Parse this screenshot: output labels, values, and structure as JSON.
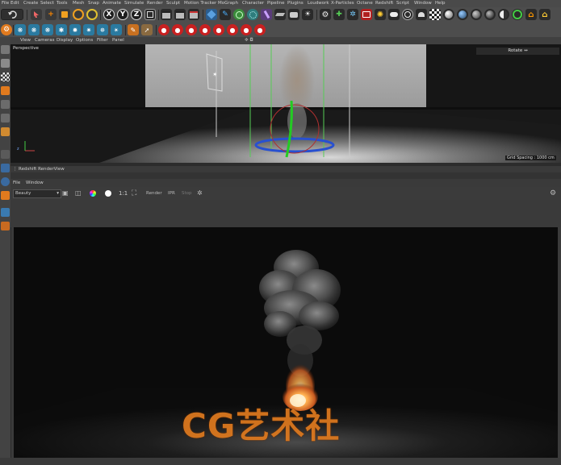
{
  "menu": [
    "File",
    "Edit",
    "Create",
    "Select",
    "Tools",
    "Mesh",
    "Snap",
    "Animate",
    "Simulate",
    "Render",
    "Sculpt",
    "Motion Tracker",
    "MoGraph",
    "Character",
    "Pipeline",
    "Plugins",
    "Loudwork",
    "X-Particles",
    "Octane",
    "Redshift",
    "Script",
    "Window",
    "Help"
  ],
  "toolbar1": {
    "axis_x": "X",
    "axis_y": "Y",
    "axis_z": "Z"
  },
  "viewport": {
    "menu": [
      "View",
      "Cameras",
      "Display",
      "Options",
      "Filter",
      "Panel"
    ],
    "label": "Perspective",
    "rotate_label": "Rotate ↔",
    "grid_spacing": "Grid Spacing : 1000 cm"
  },
  "renderview": {
    "title": "Redshift RenderView",
    "menu": [
      "File",
      "Window"
    ],
    "beauty_select": "Beauty",
    "ratio": "1:1",
    "render_label": "Render",
    "ipr_label": "IPR",
    "stop_label": "Stop"
  },
  "watermark": "CG艺术社",
  "colors": {
    "accent_orange": "#e07a1e",
    "ui_bg": "#3b3b3b",
    "viewport_bg": "#141414",
    "render_bg": "#0c0c0c"
  }
}
